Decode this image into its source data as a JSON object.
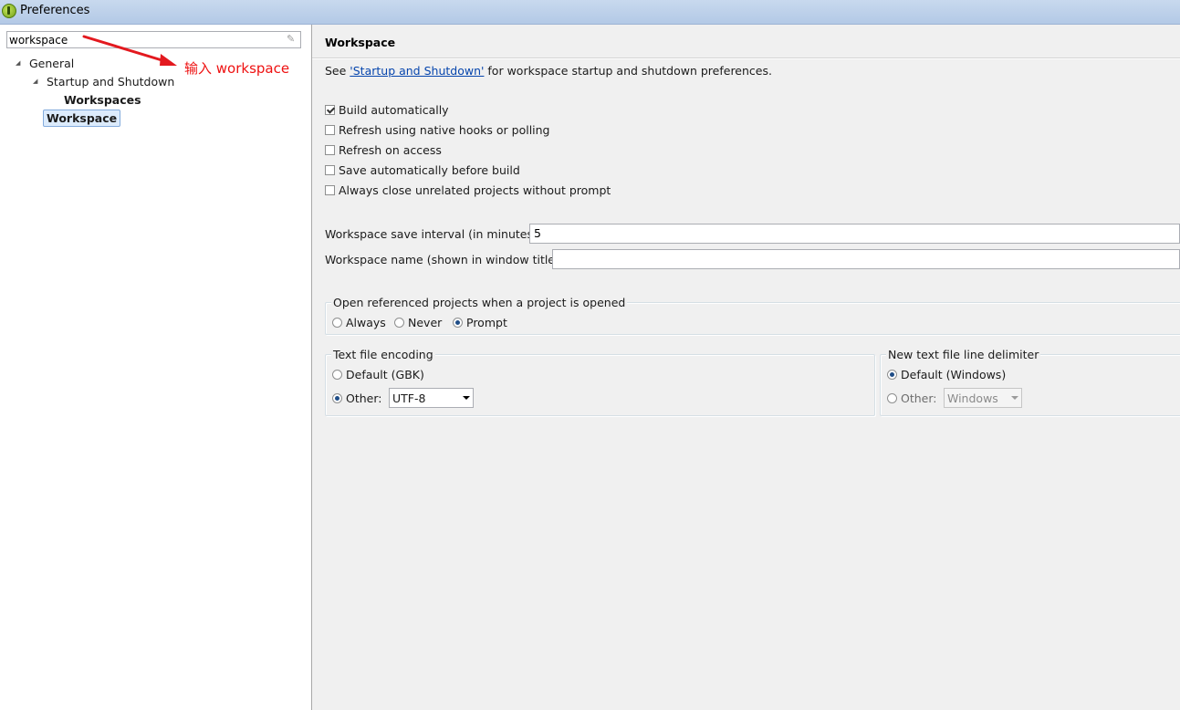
{
  "window": {
    "title": "Preferences"
  },
  "sidebar": {
    "filter_value": "workspace",
    "tree": [
      {
        "label": "General"
      },
      {
        "label": "Startup and Shutdown"
      },
      {
        "label": "Workspaces"
      },
      {
        "label": "Workspace",
        "selected": true
      }
    ]
  },
  "annotation": {
    "text": "输入 workspace",
    "color": "#ee1111"
  },
  "page": {
    "title": "Workspace",
    "see_prefix": "See ",
    "see_link": "'Startup and Shutdown'",
    "see_suffix": " for workspace startup and shutdown preferences.",
    "checkboxes": [
      {
        "label": "Build automatically",
        "checked": true
      },
      {
        "label": "Refresh using native hooks or polling",
        "checked": false
      },
      {
        "label": "Refresh on access",
        "checked": false
      },
      {
        "label": "Save automatically before build",
        "checked": false
      },
      {
        "label": "Always close unrelated projects without prompt",
        "checked": false
      }
    ],
    "save_interval_label": "Workspace save interval (in minutes):",
    "save_interval_value": "5",
    "workspace_name_label": "Workspace name (shown in window title):",
    "workspace_name_value": "",
    "open_referenced": {
      "legend": "Open referenced projects when a project is opened",
      "options": [
        "Always",
        "Never",
        "Prompt"
      ],
      "selected": "Prompt"
    },
    "text_encoding": {
      "legend": "Text file encoding",
      "default_label": "Default (GBK)",
      "other_label": "Other:",
      "other_value": "UTF-8",
      "selected": "Other"
    },
    "line_delimiter": {
      "legend": "New text file line delimiter",
      "default_label": "Default (Windows)",
      "other_label": "Other:",
      "other_value": "Windows",
      "selected": "Default"
    }
  },
  "colors": {
    "link": "#0645ad",
    "selection_bg": "#dcebfc"
  }
}
